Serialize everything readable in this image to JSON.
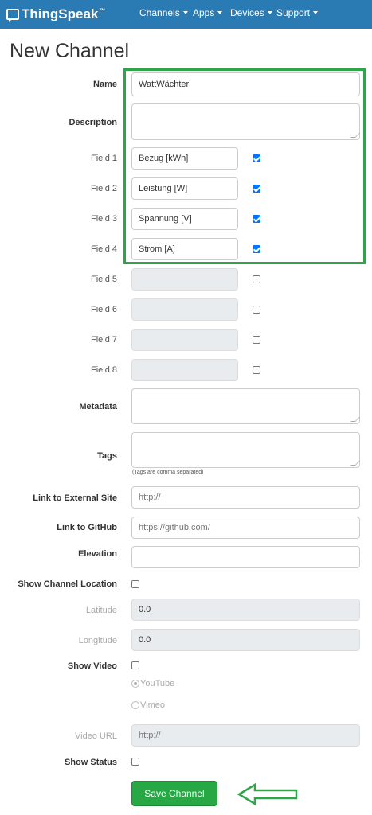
{
  "nav": {
    "brand": "ThingSpeak",
    "brand_tm": "™",
    "items": [
      {
        "label": "Channels"
      },
      {
        "label": "Apps"
      },
      {
        "label": "Devices"
      },
      {
        "label": "Support"
      }
    ]
  },
  "page_title": "New Channel",
  "form": {
    "name_label": "Name",
    "name_value": "WattWächter",
    "description_label": "Description",
    "fields": [
      {
        "label": "Field 1",
        "value": "Bezug [kWh]",
        "checked": true
      },
      {
        "label": "Field 2",
        "value": "Leistung [W]",
        "checked": true
      },
      {
        "label": "Field 3",
        "value": "Spannung [V]",
        "checked": true
      },
      {
        "label": "Field 4",
        "value": "Strom [A]",
        "checked": true
      },
      {
        "label": "Field 5",
        "value": "",
        "checked": false
      },
      {
        "label": "Field 6",
        "value": "",
        "checked": false
      },
      {
        "label": "Field 7",
        "value": "",
        "checked": false
      },
      {
        "label": "Field 8",
        "value": "",
        "checked": false
      }
    ],
    "metadata_label": "Metadata",
    "tags_label": "Tags",
    "tags_hint": "(Tags are comma separated)",
    "external_site_label": "Link to External Site",
    "external_site_placeholder": "http://",
    "github_label": "Link to GitHub",
    "github_placeholder": "https://github.com/",
    "elevation_label": "Elevation",
    "show_location_label": "Show Channel Location",
    "latitude_label": "Latitude",
    "latitude_value": "0.0",
    "longitude_label": "Longitude",
    "longitude_value": "0.0",
    "show_video_label": "Show Video",
    "youtube_label": "YouTube",
    "vimeo_label": "Vimeo",
    "video_url_label": "Video URL",
    "video_url_placeholder": "http://",
    "show_status_label": "Show Status",
    "save_label": "Save Channel"
  },
  "colors": {
    "navbar": "#2a7ab3",
    "highlight": "#2fa54a",
    "save_button": "#28a745",
    "checkbox_checked": "#0075ff"
  }
}
